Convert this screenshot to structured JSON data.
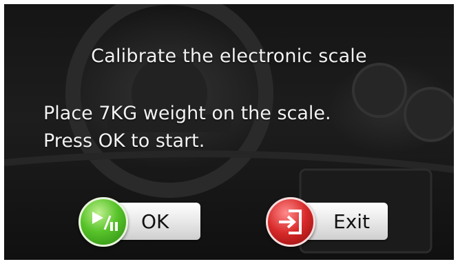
{
  "dialog": {
    "title": "Calibrate the electronic scale",
    "message_line1": "Place 7KG weight on the scale.",
    "message_line2": "Press OK to start."
  },
  "buttons": {
    "ok": {
      "label": "OK",
      "icon": "play-pause-icon",
      "icon_color": "#4cb82a"
    },
    "exit": {
      "label": "Exit",
      "icon": "exit-door-icon",
      "icon_color": "#cc2222"
    }
  }
}
